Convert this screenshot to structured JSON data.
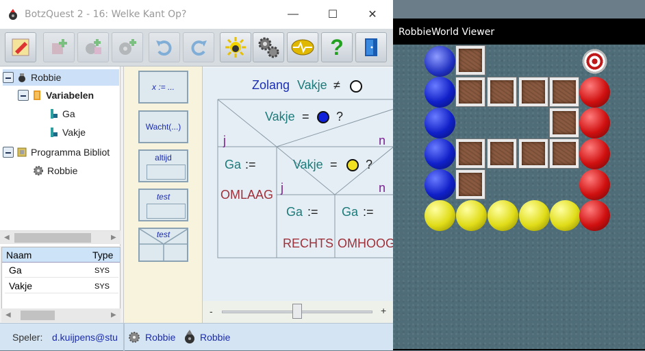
{
  "main_window": {
    "title": "BotzQuest 2 - 16: Welke Kant Op?",
    "controls": {
      "minimize": "—",
      "maximize": "☐",
      "close": "✕"
    }
  },
  "toolbar": {
    "buttons": [
      {
        "icon": "program-edit-icon",
        "enabled": true
      },
      {
        "icon": "add-component-icon",
        "enabled": false
      },
      {
        "icon": "add-gear-component-icon",
        "enabled": false
      },
      {
        "icon": "add-gear-icon",
        "enabled": false
      },
      {
        "icon": "undo-icon",
        "enabled": false
      },
      {
        "icon": "redo-icon",
        "enabled": false
      },
      {
        "icon": "run-sun-icon",
        "enabled": true
      },
      {
        "icon": "gears-icon",
        "enabled": true
      },
      {
        "icon": "heartbeat-monitor-icon",
        "enabled": true
      },
      {
        "icon": "help-icon",
        "enabled": true
      },
      {
        "icon": "exit-door-icon",
        "enabled": true
      }
    ]
  },
  "tree": {
    "items": [
      {
        "label": "Robbie",
        "bold": false,
        "selected": true
      },
      {
        "label": "Variabelen",
        "bold": true
      },
      {
        "label": "Ga"
      },
      {
        "label": "Vakje"
      },
      {
        "label": "Programma Bibliot"
      },
      {
        "label": "Robbie"
      }
    ]
  },
  "variables": {
    "headers": [
      "Naam",
      "Type"
    ],
    "rows": [
      {
        "name": "Ga",
        "type": "SYS"
      },
      {
        "name": "Vakje",
        "type": "SYS"
      }
    ]
  },
  "palette": {
    "assign": "x := ...",
    "wait": "Wacht(...)",
    "always": "altijd",
    "test1": "test",
    "test2": "test"
  },
  "nsd": {
    "while_kw": "Zolang",
    "while_var": "Vakje",
    "neq": "≠",
    "if1_var": "Vakje",
    "eq": "=",
    "q": "?",
    "yes": "j",
    "no": "n",
    "ga": "Ga",
    "assign": ":=",
    "omlaag": "OMLAAG",
    "if2_var": "Vakje",
    "rechts": "RECHTS",
    "omhoog": "OMHOOG",
    "colors": {
      "blue": "#1020d8",
      "yellow": "#f0e020"
    }
  },
  "zoom": {
    "minus": "-",
    "plus": "+",
    "value": 0.5
  },
  "status": {
    "player_label": "Speler:",
    "player": "d.kuijpens@stu",
    "robot1": "Robbie",
    "robot2": "Robbie"
  },
  "viewer": {
    "title": "RobbieWorld Viewer"
  }
}
